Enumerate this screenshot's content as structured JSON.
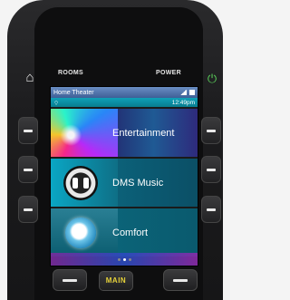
{
  "top_labels": {
    "rooms": "ROOMS",
    "power": "POWER"
  },
  "icons": {
    "home": "home-icon",
    "power": "power-icon"
  },
  "screen": {
    "status": {
      "title": "Home Theater",
      "time": "12:49pm"
    },
    "tiles": [
      {
        "label": "Entertainment"
      },
      {
        "label": "DMS Music"
      },
      {
        "label": "Comfort"
      }
    ],
    "page_dots": {
      "count": 3,
      "active": 2
    }
  },
  "bottom": {
    "main_label": "MAIN"
  },
  "colors": {
    "status_bar": "#4a70ab",
    "sub_bar": "#0a90a6",
    "main_text": "#e6d23a",
    "power_icon": "#5ad05a"
  }
}
